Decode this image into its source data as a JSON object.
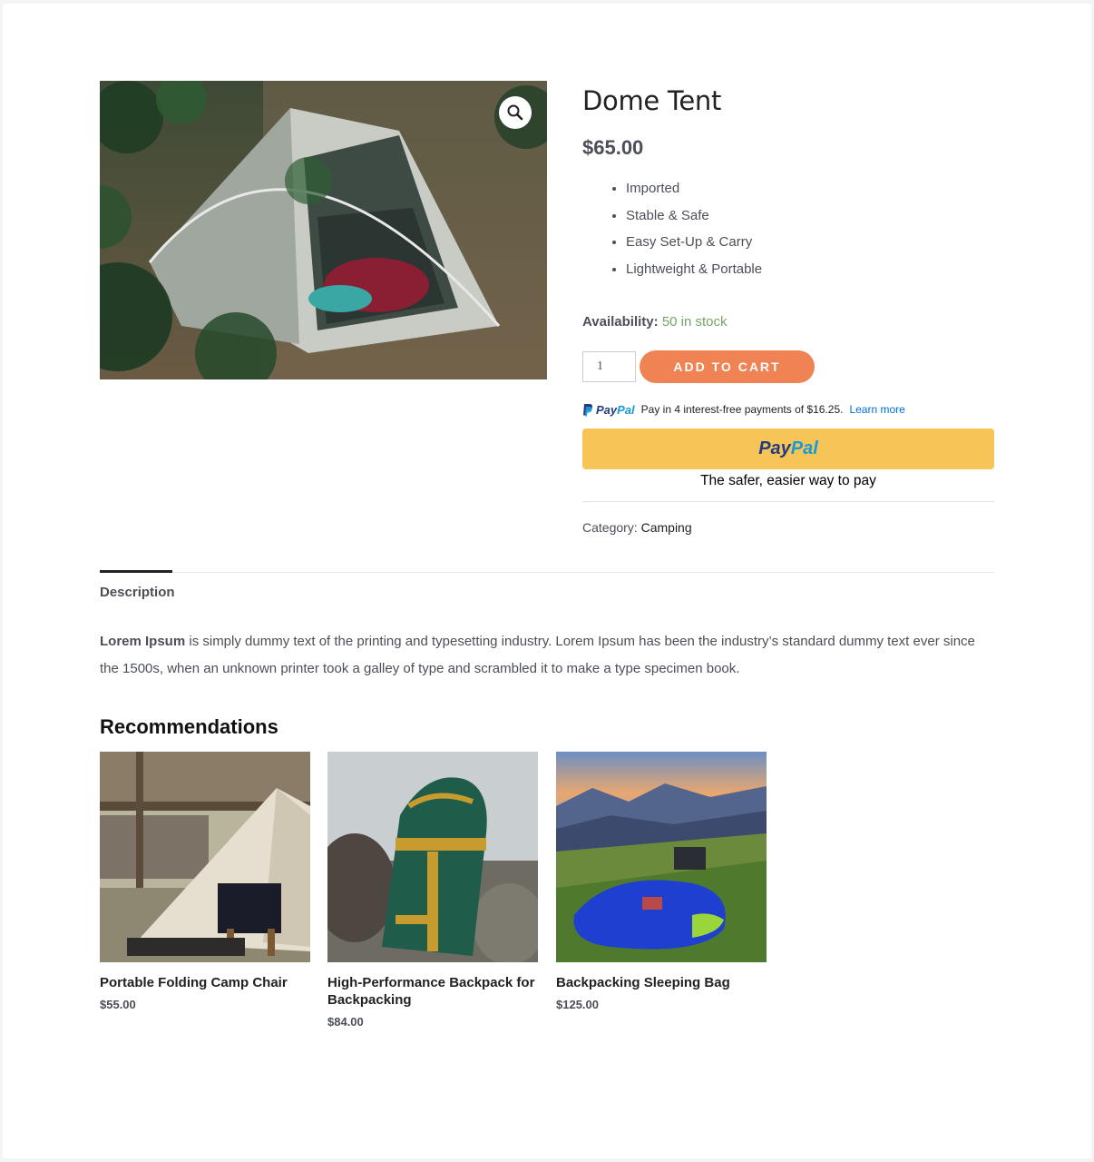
{
  "product": {
    "title": "Dome Tent",
    "price": "$65.00",
    "features": [
      "Imported",
      "Stable & Safe",
      "Easy Set-Up & Carry",
      "Lightweight & Portable"
    ],
    "availability_label": "Availability:",
    "availability_value": "50 in stock",
    "quantity": "1",
    "add_to_cart_label": "ADD TO CART",
    "category_label": "Category:",
    "category_value": "Camping"
  },
  "paypal": {
    "logo_pay": "Pay",
    "logo_pal": "Pal",
    "message": "Pay in 4 interest-free payments of $16.25.",
    "learn_more": "Learn more",
    "button_pay": "Pay",
    "button_pal": "Pal",
    "tagline": "The safer, easier way to pay"
  },
  "tabs": {
    "description_label": "Description"
  },
  "description": {
    "lead": "Lorem Ipsum",
    "body": " is simply dummy text of the printing and typesetting industry. Lorem Ipsum has been the industry’s standard dummy text ever since the 1500s, when an unknown printer took a galley of type and scrambled it to make a type specimen book."
  },
  "recommendations": {
    "title": "Recommendations",
    "items": [
      {
        "name": "Portable Folding Camp Chair",
        "price": "$55.00"
      },
      {
        "name": "High-Performance Backpack for Backpacking",
        "price": "$84.00"
      },
      {
        "name": "Backpacking Sleeping Bag",
        "price": "$125.00"
      }
    ]
  },
  "icons": {
    "zoom": "magnifier-icon",
    "paypal": "paypal-icon"
  },
  "colors": {
    "accent": "#ef8354",
    "in_stock": "#77a464",
    "paypal_button": "#f7c557",
    "paypal_link": "#0070e0"
  }
}
